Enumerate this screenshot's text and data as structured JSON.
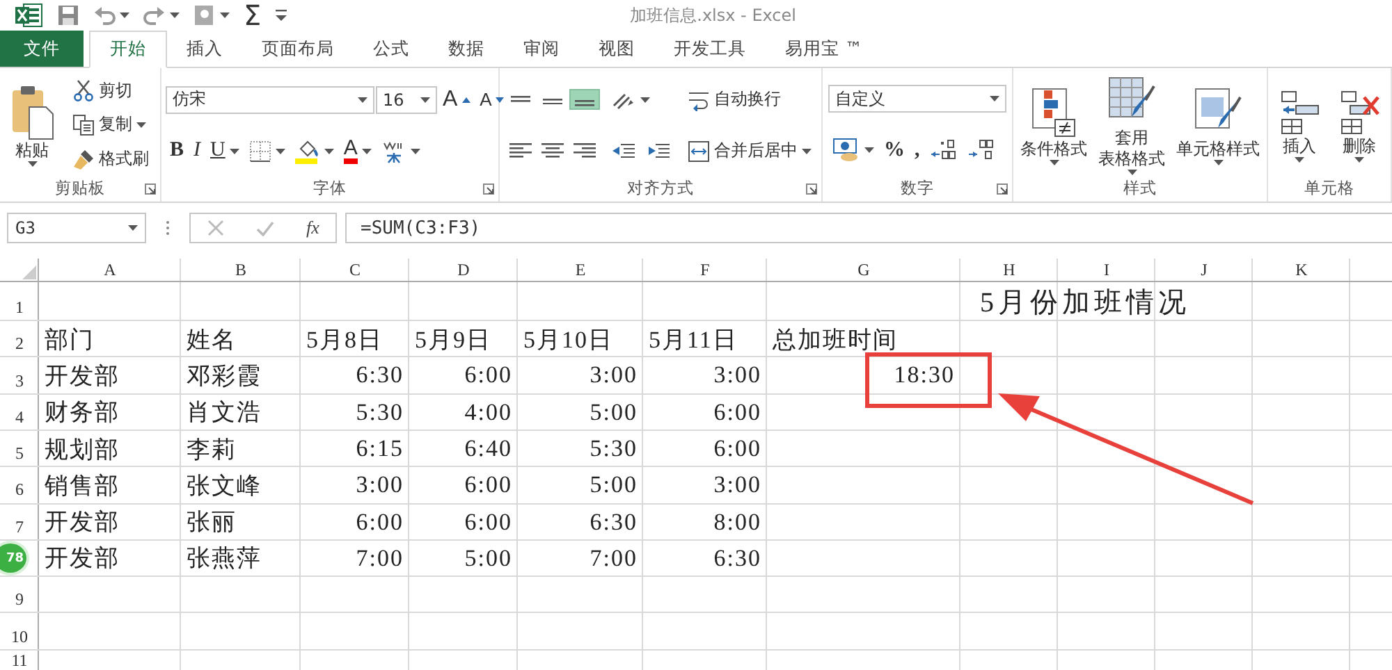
{
  "title_bar": {
    "quick_access": [
      {
        "kind": "logo"
      },
      {
        "kind": "save"
      },
      {
        "kind": "undo"
      },
      {
        "kind": "redo"
      },
      {
        "kind": "form"
      },
      {
        "kind": "sum",
        "label": "Σ"
      },
      {
        "kind": "customize"
      }
    ],
    "title": "加班信息.xlsx - Excel"
  },
  "ribbon_tabs": [
    {
      "label": "文件",
      "kind": "file",
      "selected": false
    },
    {
      "label": "开始",
      "kind": "tab",
      "selected": true
    },
    {
      "label": "插入",
      "kind": "tab",
      "selected": false
    },
    {
      "label": "页面布局",
      "kind": "tab",
      "selected": false
    },
    {
      "label": "公式",
      "kind": "tab",
      "selected": false
    },
    {
      "label": "数据",
      "kind": "tab",
      "selected": false
    },
    {
      "label": "审阅",
      "kind": "tab",
      "selected": false
    },
    {
      "label": "视图",
      "kind": "tab",
      "selected": false
    },
    {
      "label": "开发工具",
      "kind": "tab",
      "selected": false
    },
    {
      "label": "易用宝 ™",
      "kind": "tab",
      "selected": false
    }
  ],
  "ribbon_groups": [
    {
      "label": "剪贴板",
      "launcher": true,
      "columns": [
        [
          [
            {
              "kind": "paste",
              "lines": [
                "粘贴"
              ]
            }
          ]
        ],
        [
          [
            {
              "kind": "cut",
              "label": "剪切"
            }
          ],
          [
            {
              "kind": "copy",
              "label": "复制"
            }
          ],
          [
            {
              "kind": "brush",
              "label": "格式刷"
            }
          ]
        ]
      ]
    },
    {
      "label": "字体",
      "launcher": true,
      "columns": [
        [
          [
            {
              "kind": "font-field",
              "value": "仿宋"
            },
            {
              "kind": "size-field",
              "value": "16"
            },
            {
              "kind": "grow-font",
              "label": "A"
            },
            {
              "kind": "shrink-font",
              "label": "A"
            }
          ],
          [
            {
              "kind": "bold",
              "label": "B"
            },
            {
              "kind": "italic",
              "label": "I"
            },
            {
              "kind": "underline",
              "label": "U"
            },
            {
              "kind": "borders"
            },
            {
              "kind": "fill-color"
            },
            {
              "kind": "font-color",
              "label": "A"
            },
            {
              "kind": "phonetic"
            }
          ]
        ]
      ]
    },
    {
      "label": "对齐方式",
      "launcher": true,
      "columns": [
        [
          [
            {
              "kind": "align-top",
              "selected": false
            },
            {
              "kind": "align-middle",
              "selected": false
            },
            {
              "kind": "align-bottom",
              "selected": true
            }
          ],
          [
            {
              "kind": "align-left"
            },
            {
              "kind": "align-center"
            },
            {
              "kind": "align-right"
            }
          ]
        ],
        [
          [
            {
              "kind": "orientation"
            }
          ],
          [
            {
              "kind": "outdent"
            },
            {
              "kind": "indent"
            }
          ]
        ],
        [
          [
            {
              "kind": "wrap",
              "label": "自动换行"
            }
          ],
          [
            {
              "kind": "merge",
              "label": "合并后居中"
            }
          ]
        ]
      ]
    },
    {
      "label": "数字",
      "launcher": true,
      "columns": [
        [
          [
            {
              "kind": "format-field",
              "value": "自定义"
            }
          ],
          [
            {
              "kind": "accounting"
            },
            {
              "kind": "percent",
              "label": "%"
            },
            {
              "kind": "comma",
              "label": ","
            },
            {
              "kind": "inc-decimal"
            },
            {
              "kind": "dec-decimal"
            }
          ]
        ]
      ]
    },
    {
      "label": "样式",
      "launcher": false,
      "columns": [
        [
          [
            {
              "kind": "cond-format",
              "lines": [
                "条件格式"
              ]
            }
          ]
        ],
        [
          [
            {
              "kind": "table-format",
              "lines": [
                "套用",
                "表格格式"
              ]
            }
          ]
        ],
        [
          [
            {
              "kind": "cell-style",
              "lines": [
                "单元格样式"
              ]
            }
          ]
        ]
      ]
    },
    {
      "label": "单元格",
      "launcher": false,
      "columns": [
        [
          [
            {
              "kind": "insert",
              "lines": [
                "插入"
              ]
            }
          ]
        ],
        [
          [
            {
              "kind": "delete",
              "lines": [
                "删除"
              ]
            }
          ]
        ]
      ]
    }
  ],
  "formula_bar": {
    "name_box": "G3",
    "function_label": "fx",
    "formula": "=SUM(C3:F3)"
  },
  "sheet": {
    "columns": [
      "A",
      "B",
      "C",
      "D",
      "E",
      "F",
      "G",
      "H",
      "I",
      "J",
      "K"
    ],
    "rows": [
      {
        "number": "1",
        "kind": "title",
        "title": "5月份加班情况"
      },
      {
        "number": "2",
        "kind": "header",
        "cells": [
          "部门",
          "姓名",
          "5月8日",
          "5月9日",
          "5月10日",
          "5月11日",
          "总加班时间"
        ]
      },
      {
        "number": "3",
        "kind": "data",
        "cells": [
          "开发部",
          "邓彩霞",
          "6:30",
          "6:00",
          "3:00",
          "3:00",
          "18:30"
        ]
      },
      {
        "number": "4",
        "kind": "data",
        "cells": [
          "财务部",
          "肖文浩",
          "5:30",
          "4:00",
          "5:00",
          "6:00"
        ]
      },
      {
        "number": "5",
        "kind": "data",
        "cells": [
          "规划部",
          "李莉",
          "6:15",
          "6:40",
          "5:30",
          "6:00"
        ]
      },
      {
        "number": "6",
        "kind": "data",
        "cells": [
          "销售部",
          "张文峰",
          "3:00",
          "6:00",
          "5:00",
          "3:00"
        ]
      },
      {
        "number": "7",
        "kind": "data",
        "cells": [
          "开发部",
          "张丽",
          "6:00",
          "6:00",
          "6:30",
          "8:00"
        ]
      },
      {
        "kind": "data",
        "cells": [
          "开发部",
          "张燕萍",
          "7:00",
          "5:00",
          "7:00",
          "6:30"
        ]
      },
      {
        "number": "9",
        "kind": "empty"
      },
      {
        "number": "10",
        "kind": "empty"
      },
      {
        "number": "11",
        "kind": "empty"
      }
    ]
  },
  "floating_badge": {
    "text": "78"
  }
}
